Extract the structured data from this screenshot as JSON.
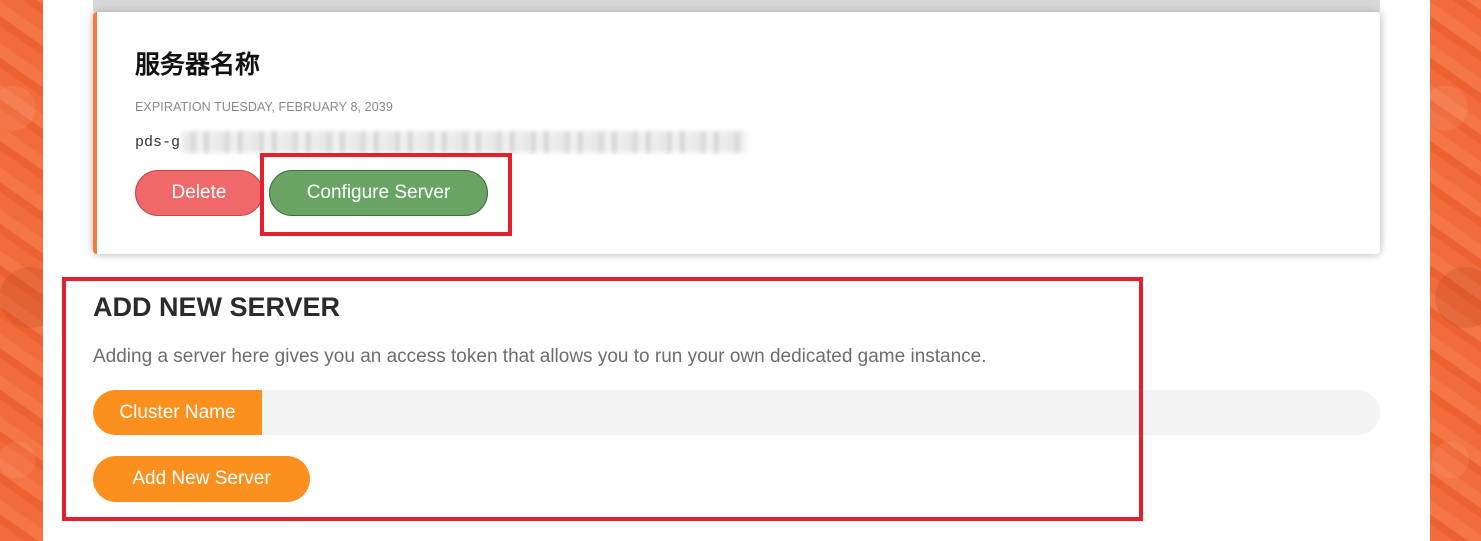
{
  "server": {
    "name": "服务器名称",
    "expiration": "EXPIRATION TUESDAY, FEBRUARY 8, 2039",
    "token_prefix": "pds-g",
    "delete_label": "Delete",
    "configure_label": "Configure Server"
  },
  "add_server": {
    "title": "ADD NEW SERVER",
    "description": "Adding a server here gives you an access token that allows you to run your own dedicated game instance.",
    "cluster_label": "Cluster Name",
    "cluster_value": "",
    "button_label": "Add New Server"
  },
  "colors": {
    "accent_orange": "#fb901f",
    "delete_red": "#f0696a",
    "configure_green": "#6aa465",
    "highlight_red": "#e4202c",
    "background_orange": "#f26b3a"
  }
}
